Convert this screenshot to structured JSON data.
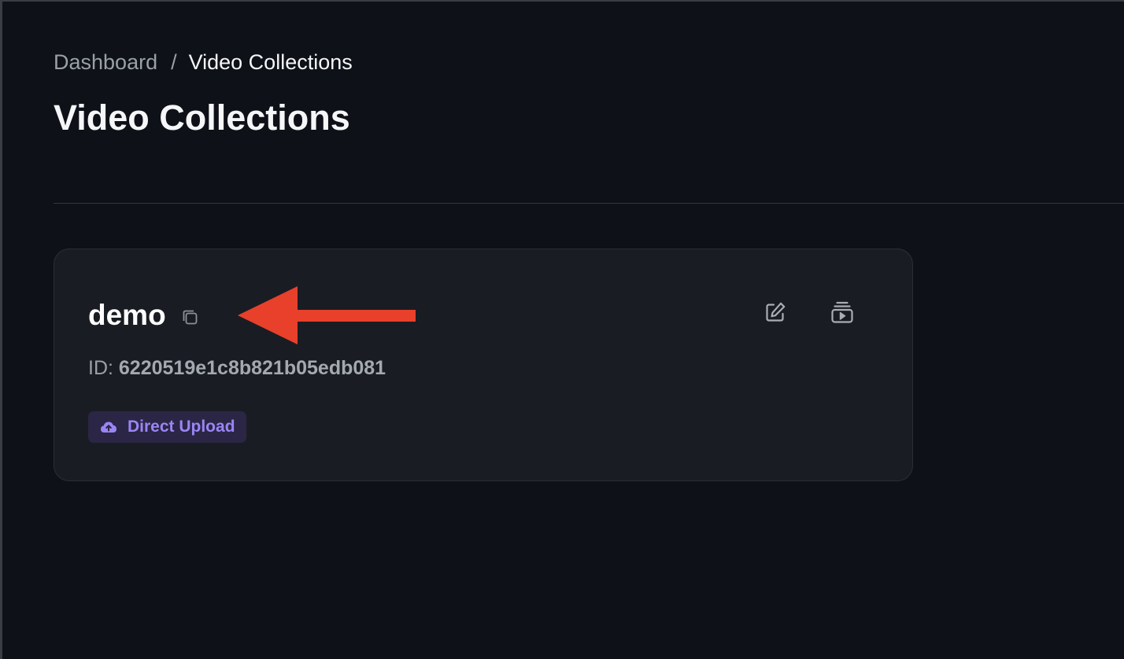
{
  "breadcrumb": {
    "parent": "Dashboard",
    "separator": "/",
    "current": "Video Collections"
  },
  "page_title": "Video Collections",
  "collection": {
    "name": "demo",
    "id_label": "ID:",
    "id_value": "6220519e1c8b821b05edb081",
    "badge_label": "Direct Upload",
    "badge_icon": "cloud-upload-icon"
  },
  "icons": {
    "copy": "copy-icon",
    "edit": "edit-icon",
    "play": "video-library-icon",
    "annotation": "red-arrow"
  },
  "colors": {
    "background": "#0e1117",
    "card": "#1a1c23",
    "badge_bg": "#2b2645",
    "badge_text": "#9b85f4",
    "annotation_arrow": "#e8402a"
  }
}
